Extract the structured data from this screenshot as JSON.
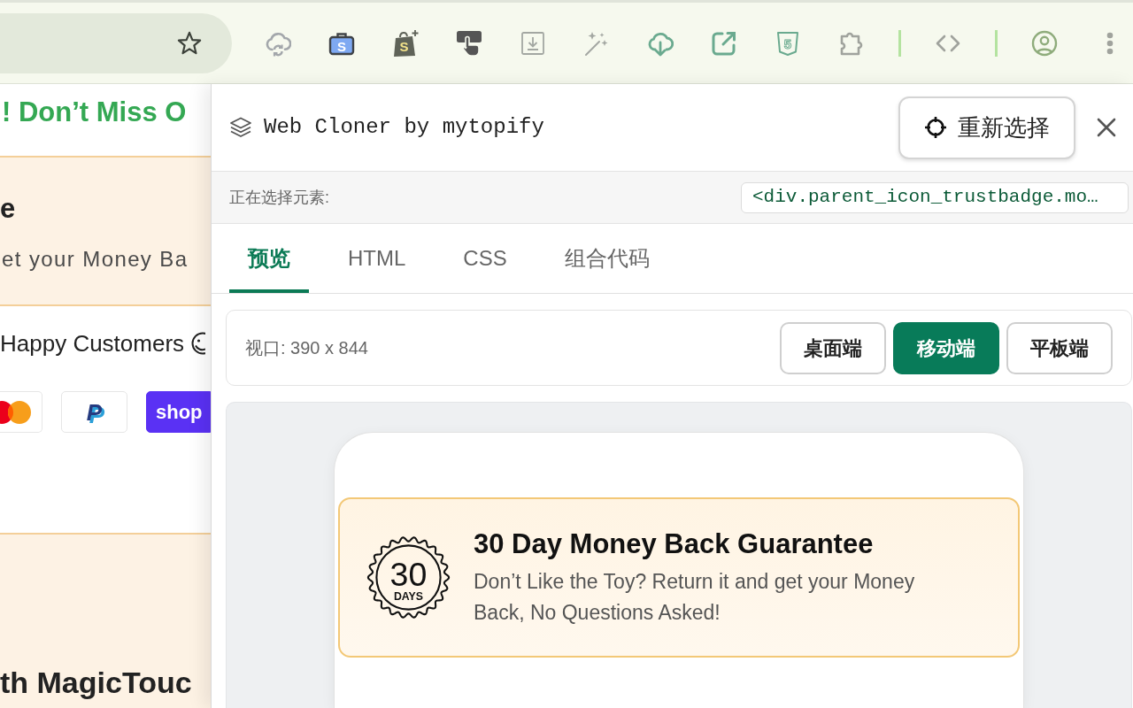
{
  "toolbar": {
    "icon_texts": [
      "S",
      "S",
      "5"
    ]
  },
  "page_behind": {
    "banner": "! Don’t Miss O",
    "guarantee_title": "e",
    "guarantee_text": "et your Money Ba",
    "customers_text": "Happy Customers",
    "payment_marks": [
      {
        "kind": "circles"
      },
      {
        "kind": "letter",
        "text": "P"
      },
      {
        "kind": "wordmark",
        "text": "shop"
      }
    ],
    "bottom_heading": "th MagicTouc"
  },
  "panel": {
    "title": "Web Cloner by mytopify",
    "reselect_button": "重新选择",
    "selection_label": "正在选择元素:",
    "selected_element": "<div.parent_icon_trustbadge.mo…",
    "tabs": [
      {
        "label": "预览",
        "selected": true
      },
      {
        "label": "HTML",
        "selected": false
      },
      {
        "label": "CSS",
        "selected": false
      },
      {
        "label": "组合代码",
        "selected": false
      }
    ],
    "viewport_label": "视口: 390 x 844",
    "devices": [
      {
        "label": "桌面端",
        "selected": false
      },
      {
        "label": "移动端",
        "selected": true
      },
      {
        "label": "平板端",
        "selected": false
      }
    ],
    "preview": {
      "seal": {
        "number": "30",
        "unit": "DAYS"
      },
      "title": "30 Day Money Back Guarantee",
      "text": "Don’t Like the Toy? Return it and get your Money Back, No Questions Asked!"
    }
  }
}
